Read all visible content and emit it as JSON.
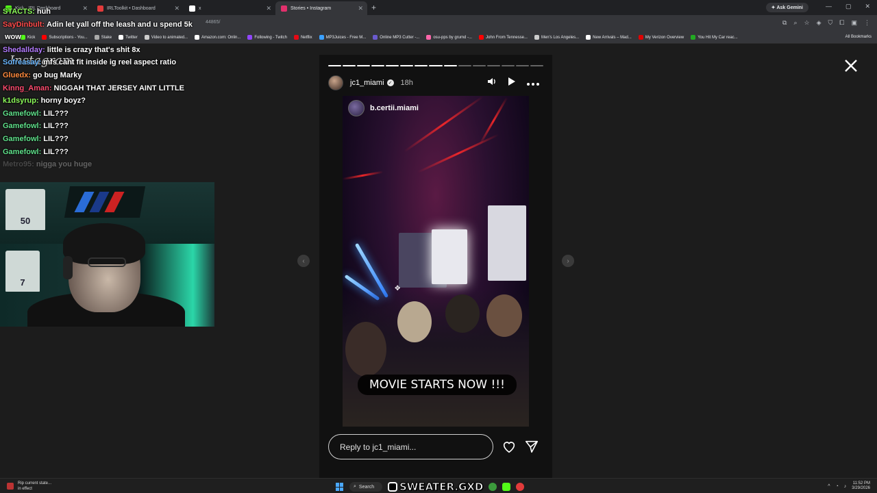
{
  "browser": {
    "tabs": [
      {
        "label": "Kick · IRL Dashboard",
        "color": "#53fc18",
        "active": false
      },
      {
        "label": "IRLToolkit • Dashboard",
        "color": "#e23b3b",
        "active": false
      },
      {
        "label": "x",
        "color": "#ffffff",
        "active": false
      },
      {
        "label": "Stories • Instagram",
        "color": "#e1306c",
        "active": true
      }
    ],
    "new_tab_icon": "+",
    "gemini_label": "Ask Gemini",
    "url": "44865/",
    "bookmarks": [
      {
        "label": "Kick",
        "color": "#53fc18"
      },
      {
        "label": "Subscriptions - You...",
        "color": "#ff0000"
      },
      {
        "label": "Stake",
        "color": "#aaaaaa"
      },
      {
        "label": "Twitter",
        "color": "#ffffff"
      },
      {
        "label": "Video to animated...",
        "color": "#cccccc"
      },
      {
        "label": "Amazon.com: Onlin...",
        "color": "#ffffff"
      },
      {
        "label": "Following - Twitch",
        "color": "#9146ff"
      },
      {
        "label": "Netflix",
        "color": "#e50914"
      },
      {
        "label": "MP3Juices - Free M...",
        "color": "#3aa0ff"
      },
      {
        "label": "Online MP3 Cutter -...",
        "color": "#6a5acd"
      },
      {
        "label": "osu-pps by grumd -...",
        "color": "#ff66aa"
      },
      {
        "label": "John From Tennesse...",
        "color": "#ff0000"
      },
      {
        "label": "Men's Los Angeles...",
        "color": "#cccccc"
      },
      {
        "label": "New Arrivals – Mad...",
        "color": "#ffffff"
      },
      {
        "label": "My Verizon Overview",
        "color": "#e00000"
      },
      {
        "label": "You Hit My Car reac...",
        "color": "#22aa22"
      }
    ],
    "all_bookmarks": "All Bookmarks"
  },
  "instagram": {
    "logo": "Instagram",
    "progress": {
      "segments": 15,
      "completed": 9
    },
    "username": "jc1_miami",
    "verified_icon": "✓",
    "time_ago": "18h",
    "reposted_from": "b.certii.miami",
    "caption": "MOVIE STARTS NOW !!!",
    "reply_placeholder": "Reply to jc1_miami...",
    "prev_arrow": "‹",
    "next_arrow": "›"
  },
  "chat": [
    {
      "name": "STACTS:",
      "text": "huh",
      "color": "#8dfb5a"
    },
    {
      "name": "SayDinbult:",
      "text": "Adin let yall off the leash and u spend 5k",
      "color": "#ff4b4b"
    },
    {
      "name": "",
      "text": "wow",
      "color": "#ffffff"
    },
    {
      "name": "Shedallday:",
      "text": "little is crazy that's shit 8x",
      "color": "#b47bff"
    },
    {
      "name": "Sofreasay:",
      "text": "mfs cant fit inside ig reel aspect ratio",
      "color": "#6ab7ff"
    },
    {
      "name": "Gluedx:",
      "text": "go bug Marky",
      "color": "#ff8a3d"
    },
    {
      "name": "Kinng_Aman:",
      "text": "NIGGAH THAT JERSEY AINT LITTLE",
      "color": "#ff4b6e"
    },
    {
      "name": "k1dsyrup:",
      "text": "horny boyz?",
      "color": "#8dfb5a"
    },
    {
      "name": "Gamefowl:",
      "text": "LIL???",
      "color": "#5fe08a"
    },
    {
      "name": "Gamefowl:",
      "text": "LIL???",
      "color": "#5fe08a"
    },
    {
      "name": "Gamefowl:",
      "text": "LIL???",
      "color": "#5fe08a"
    },
    {
      "name": "Gamefowl:",
      "text": "LIL???",
      "color": "#5fe08a"
    },
    {
      "name": "Metro95:",
      "text": "nigga you huge",
      "color": "#aaaaaa"
    }
  ],
  "webcam": {
    "jersey_number_1": "50",
    "jersey_number_2": "7"
  },
  "taskbar": {
    "notification_title": "Rip current state...",
    "notification_sub": "in effect",
    "search_label": "Search",
    "brand_overlay": "SWEATER.GXD",
    "time": "11:52 PM",
    "date": "3/29/2026"
  }
}
